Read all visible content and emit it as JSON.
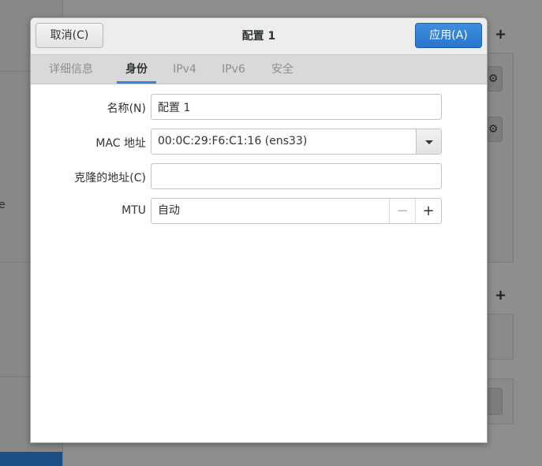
{
  "dialog": {
    "title": "配置 1",
    "cancel_label": "取消(C)",
    "apply_label": "应用(A)",
    "accent_color": "#3584e4"
  },
  "tabs": [
    {
      "label": "详细信息",
      "active": false
    },
    {
      "label": "身份",
      "active": true
    },
    {
      "label": "IPv4",
      "active": false
    },
    {
      "label": "IPv6",
      "active": false
    },
    {
      "label": "安全",
      "active": false
    }
  ],
  "form": {
    "name_label": "名称(N)",
    "name_value": "配置 1",
    "mac_label": "MAC 地址",
    "mac_value": "00:0C:29:F6:C1:16 (ens33)",
    "cloned_label": "克隆的地址(C)",
    "cloned_value": "",
    "mtu_label": "MTU",
    "mtu_value": "自动",
    "mtu_minus": "−",
    "mtu_plus": "+"
  },
  "background": {
    "sidebar_fragment": "e",
    "plus_1": "+",
    "plus_2": "+"
  }
}
